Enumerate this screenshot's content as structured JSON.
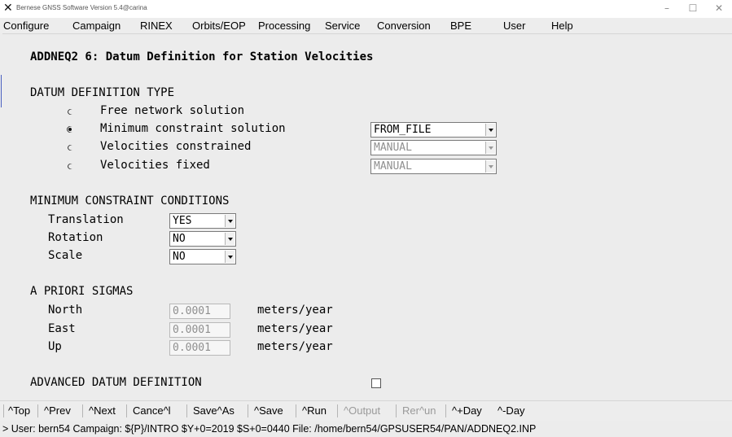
{
  "window": {
    "title": "Bernese GNSS Software Version 5.4@carina",
    "icon": "x-logo-icon",
    "controls": [
      "minimize",
      "maximize",
      "close"
    ]
  },
  "menu": [
    "Configure",
    "Campaign",
    "RINEX",
    "Orbits/EOP",
    "Processing",
    "Service",
    "Conversion",
    "BPE",
    "User",
    "Help"
  ],
  "panel": {
    "title": "ADDNEQ2 6: Datum Definition for Station Velocities"
  },
  "datum_type": {
    "header": "DATUM DEFINITION TYPE",
    "options": [
      {
        "label": "Free network solution",
        "selected": false
      },
      {
        "label": "Minimum constraint solution",
        "selected": true,
        "dropdown": "FROM_FILE",
        "enabled": true
      },
      {
        "label": "Velocities constrained",
        "selected": false,
        "dropdown": "MANUAL",
        "enabled": false
      },
      {
        "label": "Velocities fixed",
        "selected": false,
        "dropdown": "MANUAL",
        "enabled": false
      }
    ]
  },
  "min_constraint": {
    "header": "MINIMUM CONSTRAINT CONDITIONS",
    "rows": [
      {
        "label": "Translation",
        "value": "YES"
      },
      {
        "label": "Rotation",
        "value": "NO"
      },
      {
        "label": "Scale",
        "value": "NO"
      }
    ]
  },
  "sigmas": {
    "header": "A PRIORI SIGMAS",
    "unit": "meters/year",
    "rows": [
      {
        "label": "North",
        "value": "0.0001"
      },
      {
        "label": "East",
        "value": "0.0001"
      },
      {
        "label": "Up",
        "value": "0.0001"
      }
    ]
  },
  "advanced": {
    "label": "ADVANCED DATUM DEFINITION",
    "checked": false
  },
  "statusbar": {
    "buttons": [
      {
        "label": "^Top",
        "enabled": true
      },
      {
        "label": "^Prev",
        "enabled": true
      },
      {
        "label": "^Next",
        "enabled": true
      },
      {
        "label": "Cance^l",
        "enabled": true
      },
      {
        "label": "Save^As",
        "enabled": true
      },
      {
        "label": "^Save",
        "enabled": true
      },
      {
        "label": "^Run",
        "enabled": true
      },
      {
        "label": "^Output",
        "enabled": false
      },
      {
        "label": "Rer^un",
        "enabled": false
      },
      {
        "label": "^+Day",
        "enabled": true
      },
      {
        "label": "^-Day",
        "enabled": true
      }
    ]
  },
  "info": "> User: bern54  Campaign: ${P}/INTRO  $Y+0=2019  $S+0=0440  File: /home/bern54/GPSUSER54/PAN/ADDNEQ2.INP"
}
